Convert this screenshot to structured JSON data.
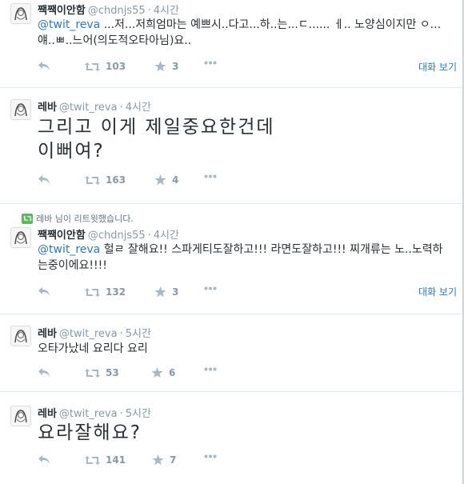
{
  "tweets": [
    {
      "fullname": "짹짹이안함",
      "username": "@chdnjs55",
      "time": "4시간",
      "text_mention": "@twit_reva",
      "text_body": " ...저...저희엄마는 예쁘시..다고...하..는...ㄷ...... ㅔ.. 노양심이지만 ㅇ...얘..ㅃ..느어(의도적오타아님)요..",
      "retweets": "103",
      "favorites": "3",
      "expand": "대화 보기"
    },
    {
      "fullname": "레바",
      "username": "@twit_reva",
      "time": "4시간",
      "text_line1": "그리고 이게 제일중요한건데",
      "text_line2": "이뻐여?",
      "retweets": "163",
      "favorites": "4"
    },
    {
      "retweet_context": "레바 님이 리트윗했습니다.",
      "fullname": "짹짹이안함",
      "username": "@chdnjs55",
      "time": "4시간",
      "text_mention": "@twit_reva",
      "text_body": " 헐ㄹ 잘해요!! 스파게티도잘하고!!! 라면도잘하고!!! 찌개류는 노..노력하는중이에요!!!!",
      "retweets": "132",
      "favorites": "3",
      "expand": "대화 보기"
    },
    {
      "fullname": "레바",
      "username": "@twit_reva",
      "time": "5시간",
      "text": "오타가났네 요리다 요리",
      "retweets": "53",
      "favorites": "6"
    },
    {
      "fullname": "레바",
      "username": "@twit_reva",
      "time": "5시간",
      "text": "요라잘해요?",
      "retweets": "141",
      "favorites": "7"
    }
  ],
  "icons": {
    "reply": "reply-icon",
    "retweet": "retweet-icon",
    "favorite": "star-icon",
    "more": "more-icon"
  },
  "colors": {
    "link": "#2b7bb9",
    "muted": "#8899a6",
    "retweet_badge": "#5cb85c"
  }
}
